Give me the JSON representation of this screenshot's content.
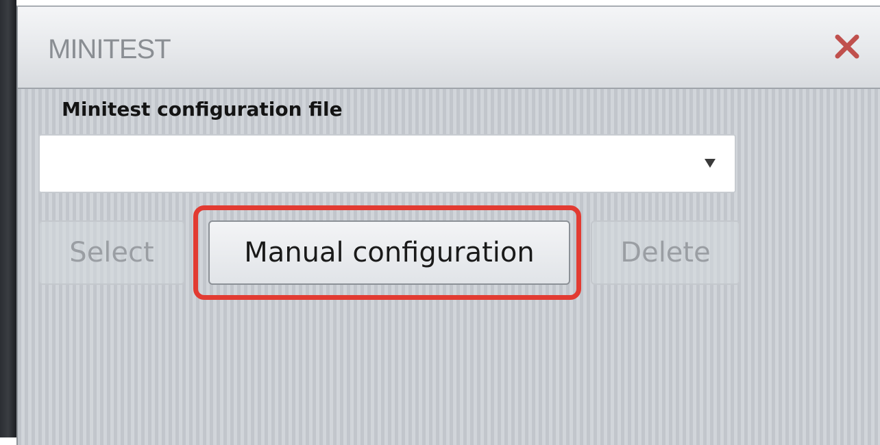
{
  "window": {
    "title": "MINITEST",
    "close_icon": "close-icon",
    "close_color": "#c0504d"
  },
  "config": {
    "label": "Minitest configuration file",
    "dropdown": {
      "selected_value": "",
      "arrow_icon": "dropdown-arrow-icon"
    }
  },
  "buttons": {
    "select_label": "Select",
    "manual_label": "Manual configuration",
    "delete_label": "Delete"
  },
  "annotation": {
    "highlight_color": "#e23b32",
    "highlighted": "Manual configuration"
  }
}
